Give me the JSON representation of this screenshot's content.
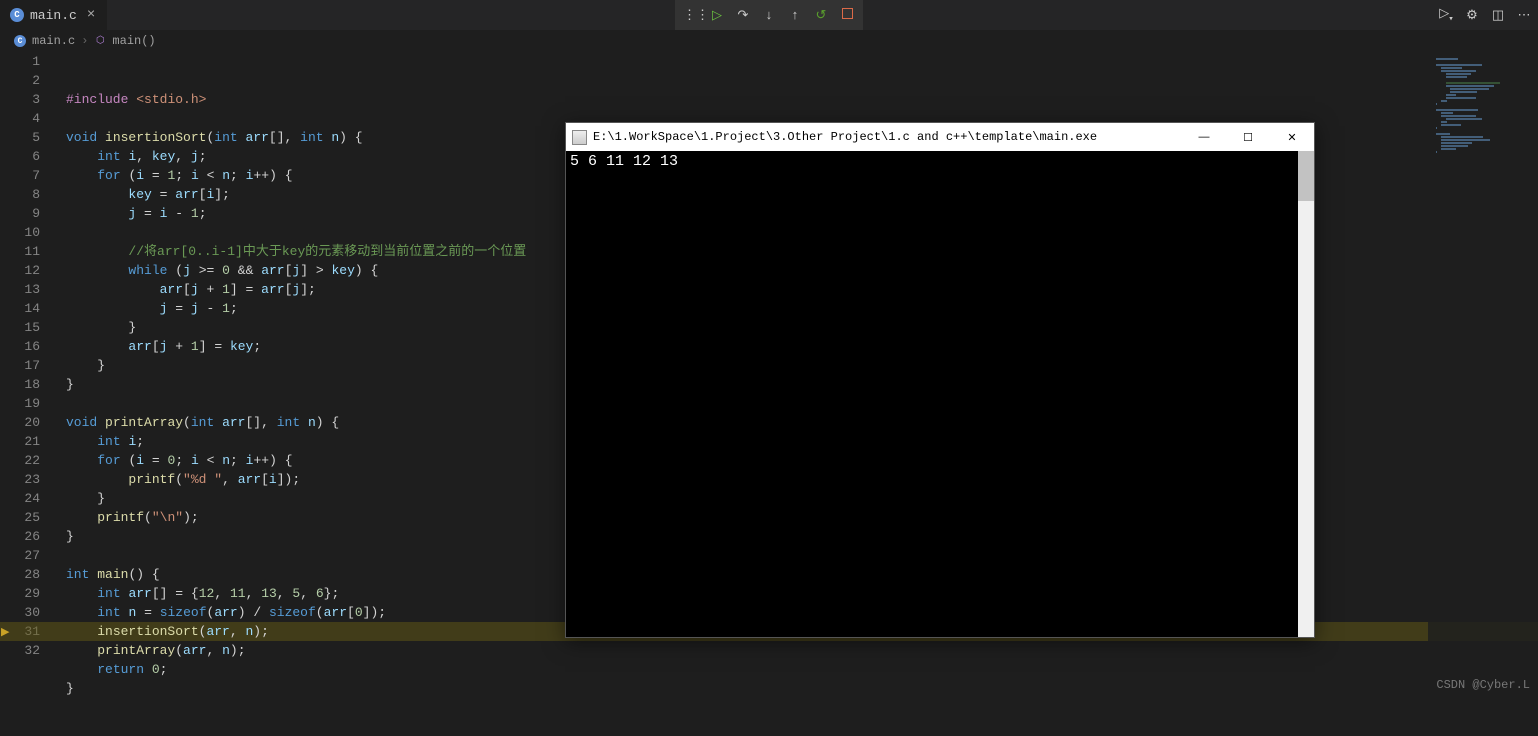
{
  "tab": {
    "filename": "main.c"
  },
  "breadcrumb": {
    "file": "main.c",
    "symbol": "main()"
  },
  "toolbar_icons": {
    "grip": "grip-icon",
    "play": "continue-icon",
    "stepover": "step-over-icon",
    "stepin": "step-into-icon",
    "stepout": "step-out-icon",
    "restart": "restart-icon",
    "stop": "stop-icon",
    "runside": "run-menu-icon",
    "settings": "settings-gear-icon",
    "split": "split-editor-icon",
    "more": "more-icon"
  },
  "code": [
    "#include <stdio.h>",
    "",
    "void insertionSort(int arr[], int n) {",
    "    int i, key, j;",
    "    for (i = 1; i < n; i++) {",
    "        key = arr[i];",
    "        j = i - 1;",
    "",
    "        //将arr[0..i-1]中大于key的元素移动到当前位置之前的一个位置",
    "        while (j >= 0 && arr[j] > key) {",
    "            arr[j + 1] = arr[j];",
    "            j = j - 1;",
    "        }",
    "        arr[j + 1] = key;",
    "    }",
    "}",
    "",
    "void printArray(int arr[], int n) {",
    "    int i;",
    "    for (i = 0; i < n; i++) {",
    "        printf(\"%d \", arr[i]);",
    "    }",
    "    printf(\"\\n\");",
    "}",
    "",
    "int main() {",
    "    int arr[] = {12, 11, 13, 5, 6};",
    "    int n = sizeof(arr) / sizeof(arr[0]);",
    "    insertionSort(arr, n);",
    "    printArray(arr, n);",
    "    return 0;",
    "}"
  ],
  "current_line": 31,
  "console": {
    "title": "E:\\1.WorkSpace\\1.Project\\3.Other Project\\1.c and c++\\template\\main.exe",
    "output": "5 6 11 12 13"
  },
  "watermark": "CSDN @Cyber.L"
}
